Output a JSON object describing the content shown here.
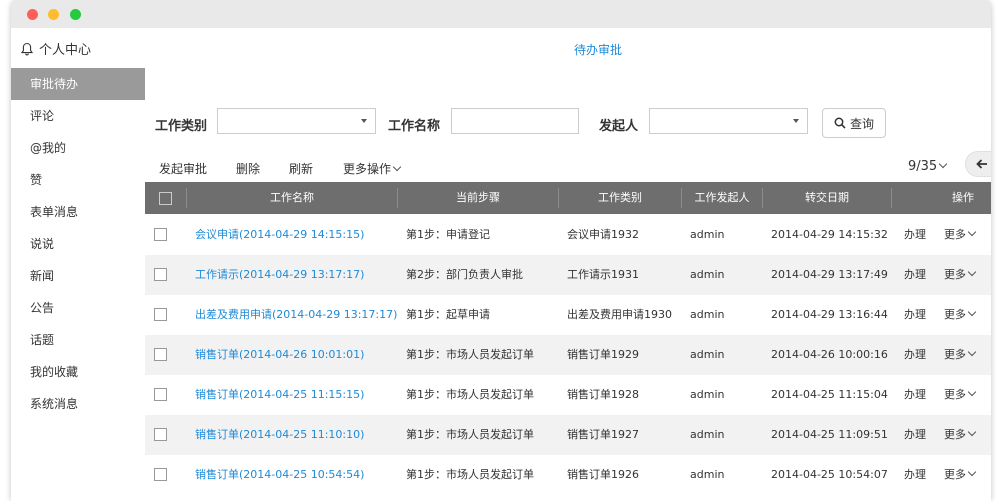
{
  "topbar": {
    "personal_center": "个人中心",
    "page_title": "待办审批"
  },
  "sidebar": {
    "items": [
      {
        "label": "审批待办",
        "active": true
      },
      {
        "label": "评论"
      },
      {
        "label": "@我的"
      },
      {
        "label": "赞"
      },
      {
        "label": "表单消息"
      },
      {
        "label": "说说"
      },
      {
        "label": "新闻"
      },
      {
        "label": "公告"
      },
      {
        "label": "话题"
      },
      {
        "label": "我的收藏"
      },
      {
        "label": "系统消息"
      }
    ]
  },
  "filters": {
    "work_type_label": "工作类别",
    "work_name_label": "工作名称",
    "initiator_label": "发起人",
    "query_label": "查询"
  },
  "toolbar": {
    "start_label": "发起审批",
    "delete_label": "删除",
    "refresh_label": "刷新",
    "more_label": "更多操作"
  },
  "pager": {
    "text": "9/35"
  },
  "table": {
    "headers": {
      "name": "工作名称",
      "step": "当前步骤",
      "type": "工作类别",
      "initiator": "工作发起人",
      "date": "转交日期",
      "ops": "操作"
    },
    "rows": [
      {
        "name": "会议申请(2014-04-29 14:15:15)",
        "step": "第1步：申请登记",
        "type": "会议申请1932",
        "initiator": "admin",
        "date": "2014-04-29 14:15:32",
        "handle": "办理",
        "more": "更多"
      },
      {
        "name": "工作请示(2014-04-29 13:17:17)",
        "step": "第2步：部门负责人审批",
        "type": "工作请示1931",
        "initiator": "admin",
        "date": "2014-04-29 13:17:49",
        "handle": "办理",
        "more": "更多"
      },
      {
        "name": "出差及费用申请(2014-04-29 13:17:17)",
        "step": "第1步：起草申请",
        "type": "出差及费用申请1930",
        "initiator": "admin",
        "date": "2014-04-29 13:16:44",
        "handle": "办理",
        "more": "更多"
      },
      {
        "name": "销售订单(2014-04-26 10:01:01)",
        "step": "第1步：市场人员发起订单",
        "type": "销售订单1929",
        "initiator": "admin",
        "date": "2014-04-26 10:00:16",
        "handle": "办理",
        "more": "更多"
      },
      {
        "name": "销售订单(2014-04-25 11:15:15)",
        "step": "第1步：市场人员发起订单",
        "type": "销售订单1928",
        "initiator": "admin",
        "date": "2014-04-25 11:15:04",
        "handle": "办理",
        "more": "更多"
      },
      {
        "name": "销售订单(2014-04-25 11:10:10)",
        "step": "第1步：市场人员发起订单",
        "type": "销售订单1927",
        "initiator": "admin",
        "date": "2014-04-25 11:09:51",
        "handle": "办理",
        "more": "更多"
      },
      {
        "name": "销售订单(2014-04-25 10:54:54)",
        "step": "第1步：市场人员发起订单",
        "type": "销售订单1926",
        "initiator": "admin",
        "date": "2014-04-25 10:54:07",
        "handle": "办理",
        "more": "更多"
      }
    ]
  }
}
